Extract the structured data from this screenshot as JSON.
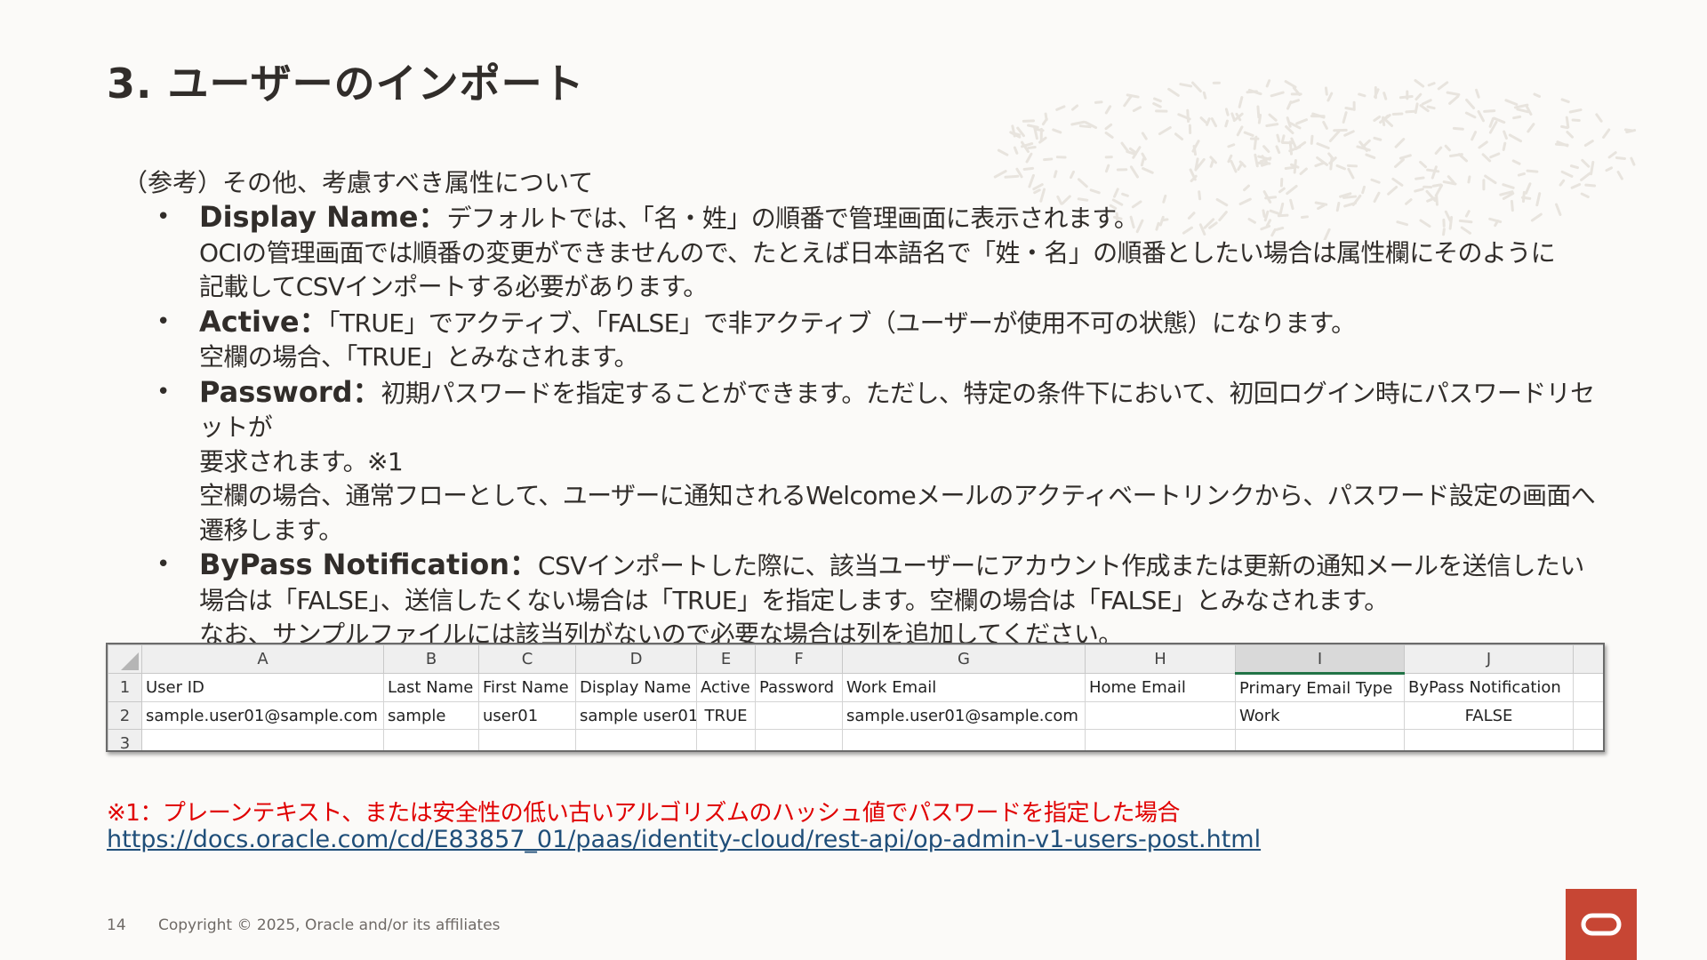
{
  "title": "3. ユーザーのインポート",
  "intro": "（参考）その他、考慮すべき属性について",
  "attributes": [
    {
      "term": "Display Name",
      "sep": "：",
      "lines": [
        "デフォルトでは、「名・姓」の順番で管理画面に表示されます。",
        "OCIの管理画面では順番の変更ができませんので、たとえば日本語名で「姓・名」の順番としたい場合は属性欄にそのように",
        "記載してCSVインポートする必要があります。"
      ]
    },
    {
      "term": "Active",
      "sep": "：",
      "lines": [
        "「TRUE」でアクティブ、「FALSE」で非アクティブ（ユーザーが使用不可の状態）になります。",
        "空欄の場合、「TRUE」とみなされます。"
      ]
    },
    {
      "term": "Password",
      "sep": "：",
      "lines": [
        "初期パスワードを指定することができます。ただし、特定の条件下において、初回ログイン時にパスワードリセットが",
        "要求されます。※1",
        "空欄の場合、通常フローとして、ユーザーに通知されるWelcomeメールのアクティベートリンクから、パスワード設定の画面へ",
        "遷移します。"
      ]
    },
    {
      "term": "ByPass Notification",
      "sep": "：",
      "lines": [
        "CSVインポートした際に、該当ユーザーにアカウント作成または更新の通知メールを送信したい",
        "場合は「FALSE」、送信したくない場合は「TRUE」を指定します。空欄の場合は「FALSE」とみなされます。",
        "なお、サンプルファイルには該当列がないので必要な場合は列を追加してください。"
      ]
    }
  ],
  "spreadsheet": {
    "columns": [
      "A",
      "B",
      "C",
      "D",
      "E",
      "F",
      "G",
      "H",
      "I",
      "J"
    ],
    "rows": [
      {
        "num": "1",
        "cells": [
          "User ID",
          "Last Name",
          "First Name",
          "Display Name",
          "Active",
          "Password",
          "Work Email",
          "Home Email",
          "Primary Email Type",
          "ByPass Notification"
        ]
      },
      {
        "num": "2",
        "cells": [
          "sample.user01@sample.com",
          "sample",
          "user01",
          "sample user01",
          "TRUE",
          "",
          "sample.user01@sample.com",
          "",
          "Work",
          "FALSE"
        ]
      },
      {
        "num": "3",
        "cells": [
          "",
          "",
          "",
          "",
          "",
          "",
          "",
          "",
          "",
          ""
        ]
      }
    ]
  },
  "footnote": "※1：プレーンテキスト、または安全性の低い古いアルゴリズムのハッシュ値でパスワードを指定した場合",
  "link": "https://docs.oracle.com/cd/E83857_01/paas/identity-cloud/rest-api/op-admin-v1-users-post.html",
  "footer": {
    "page": "14",
    "copyright": "Copyright © 2025, Oracle and/or its affiliates"
  },
  "colors": {
    "accent": "#c74634",
    "footnote": "#e00000",
    "link": "#1f4e79",
    "text": "#312d2a"
  }
}
